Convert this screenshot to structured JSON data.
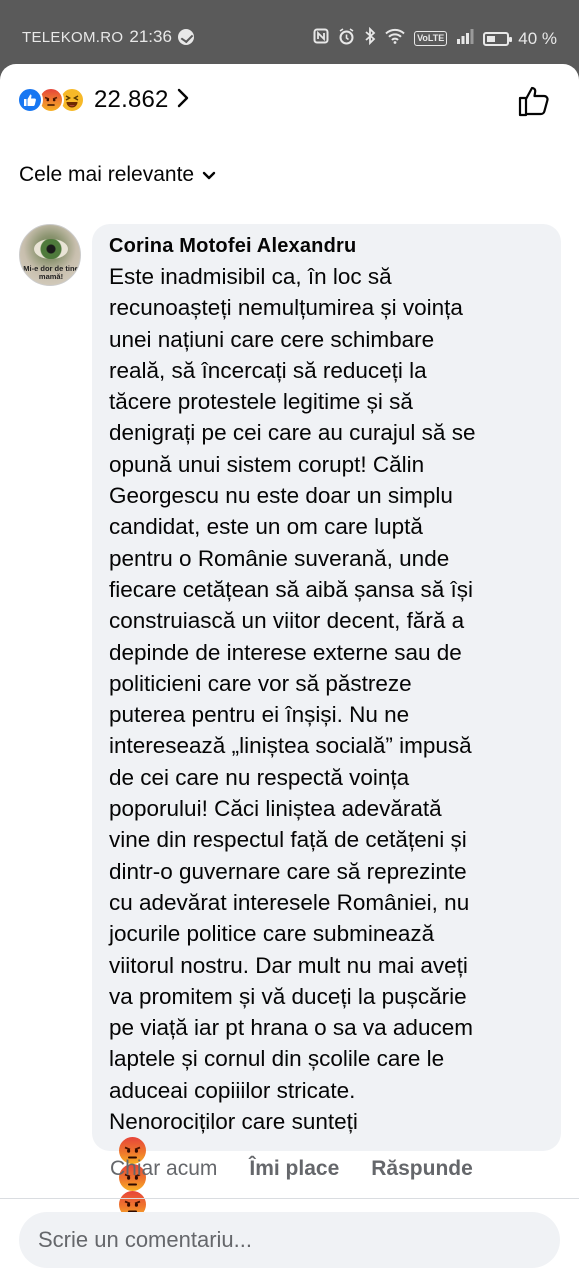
{
  "status_bar": {
    "carrier": "TELEKOM.RO",
    "time": "21:36",
    "volte": "VoLTE",
    "battery_pct": "40 %",
    "icons": [
      "messenger-icon",
      "nfc-icon",
      "alarm-icon",
      "bluetooth-icon",
      "wifi-icon",
      "volte-icon",
      "signal-icon",
      "battery-icon"
    ]
  },
  "reactions": {
    "types": [
      "like",
      "angry",
      "haha"
    ],
    "count": "22.862"
  },
  "sort": {
    "label": "Cele mai relevante"
  },
  "comment": {
    "author": "Corina Motofei Alexandru",
    "avatar_text": "Mi-e dor de tine mamă!",
    "text_lines": [
      "Este inadmisibil ca, în loc să",
      "recunoașteți nemulțumirea și voința",
      "unei națiuni care cere schimbare",
      "reală, să încercați să reduceți la",
      "tăcere protestele legitime și să",
      "denigrați pe cei care au curajul să se",
      "opună unui sistem corupt! Călin",
      "Georgescu nu este doar un simplu",
      "candidat, este un om care luptă",
      "pentru o Românie suverană, unde",
      "fiecare cetățean să aibă șansa să își",
      "construiască un viitor decent, fără a",
      "depinde de interese externe sau de",
      "politicieni care vor să păstreze",
      "puterea pentru ei înșiși. Nu ne",
      "interesează „liniștea socială” impusă",
      "de cei care nu respectă voința",
      "poporului! Căci liniștea adevărată",
      "vine din respectul față de cetățeni și",
      "dintr-o guvernare care să reprezinte",
      "cu adevărat interesele României, nu",
      "jocurile politice care subminează",
      "viitorul nostru. Dar mult nu mai aveți",
      "va promitem și vă duceți la pușcărie",
      "pe viață iar pt hrana o sa va aducem",
      "laptele și cornul din școlile care le",
      "aduceai copiiilor stricate."
    ],
    "last_line": "Nenorociților care sunteți",
    "last_emojis": [
      "angry-emoji-icon",
      "angry-emoji-icon",
      "angry-emoji-icon",
      "angry-emoji-icon"
    ],
    "time": "Chiar acum",
    "like_label": "Îmi place",
    "reply_label": "Răspunde"
  },
  "composer": {
    "placeholder": "Scrie un comentariu..."
  },
  "colors": {
    "like_blue": "#1877f2",
    "bubble_bg": "#f0f2f5",
    "secondary_text": "#65676b",
    "status_bar_bg": "#5a5a5a"
  }
}
